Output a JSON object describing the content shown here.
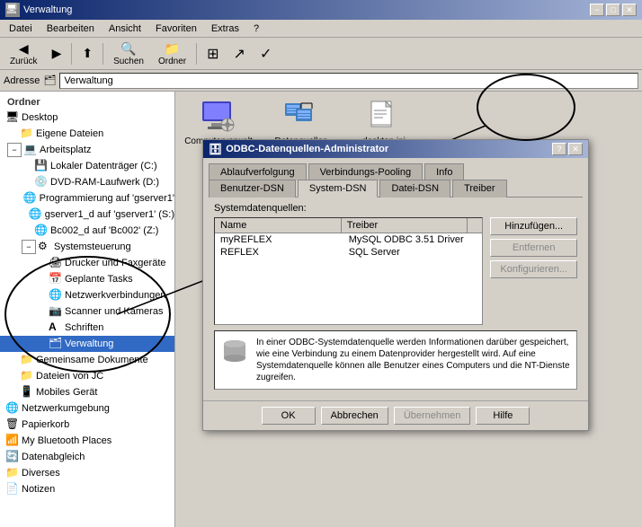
{
  "window": {
    "title": "Verwaltung",
    "title_icon": "🖥",
    "min_btn": "−",
    "max_btn": "□",
    "close_btn": "✕"
  },
  "menu": {
    "items": [
      "Datei",
      "Bearbeiten",
      "Ansicht",
      "Favoriten",
      "Extras",
      "?"
    ]
  },
  "toolbar": {
    "back_label": "Zurück",
    "forward_label": "→",
    "up_label": "↑",
    "search_label": "Suchen",
    "folders_label": "Ordner",
    "views_label": "⊞",
    "move_label": "↗",
    "check_label": "✓"
  },
  "address": {
    "label": "Adresse",
    "value": "Verwaltung",
    "icon": "🗂"
  },
  "sidebar": {
    "header": "Ordner",
    "items": [
      {
        "id": "desktop",
        "label": "Desktop",
        "indent": 0,
        "icon": "🖥",
        "expandable": false
      },
      {
        "id": "eigene",
        "label": "Eigene Dateien",
        "indent": 1,
        "icon": "📁",
        "expandable": false
      },
      {
        "id": "arbeitsplatz",
        "label": "Arbeitsplatz",
        "indent": 1,
        "icon": "💻",
        "expandable": true
      },
      {
        "id": "lokal-c",
        "label": "Lokaler Datenträger (C:)",
        "indent": 2,
        "icon": "💾",
        "expandable": false
      },
      {
        "id": "dvd-d",
        "label": "DVD-RAM-Laufwerk (D:)",
        "indent": 2,
        "icon": "💿",
        "expandable": false
      },
      {
        "id": "prog-gserver",
        "label": "Programmierung auf 'gserver1'",
        "indent": 2,
        "icon": "🌐",
        "expandable": false
      },
      {
        "id": "gserver1",
        "label": "gserver1_d auf 'gserver1' (S:)",
        "indent": 2,
        "icon": "🌐",
        "expandable": false
      },
      {
        "id": "bc002",
        "label": "Bc002_d auf 'Bc002' (Z:)",
        "indent": 2,
        "icon": "🌐",
        "expandable": false
      },
      {
        "id": "systemsteuerung",
        "label": "Systemsteuerung",
        "indent": 2,
        "icon": "⚙",
        "expandable": true
      },
      {
        "id": "drucker",
        "label": "Drucker und Faxgeräte",
        "indent": 3,
        "icon": "🖨",
        "expandable": false
      },
      {
        "id": "geplante",
        "label": "Geplante Tasks",
        "indent": 3,
        "icon": "📅",
        "expandable": false
      },
      {
        "id": "netzwerk",
        "label": "Netzwerkverbindungen",
        "indent": 3,
        "icon": "🌐",
        "expandable": false
      },
      {
        "id": "scanner",
        "label": "Scanner und Kameras",
        "indent": 3,
        "icon": "📷",
        "expandable": false
      },
      {
        "id": "schriften",
        "label": "Schriften",
        "indent": 3,
        "icon": "A",
        "expandable": false
      },
      {
        "id": "verwaltung",
        "label": "Verwaltung",
        "indent": 3,
        "icon": "🗂",
        "expandable": false
      },
      {
        "id": "gemeinsame",
        "label": "Gemeinsame Dokumente",
        "indent": 1,
        "icon": "📁",
        "expandable": false
      },
      {
        "id": "dateien-jc",
        "label": "Dateien von JC",
        "indent": 1,
        "icon": "📁",
        "expandable": false
      },
      {
        "id": "mobiles",
        "label": "Mobiles Gerät",
        "indent": 1,
        "icon": "📱",
        "expandable": false
      },
      {
        "id": "netzwerkumgebung",
        "label": "Netzwerkumgebung",
        "indent": 0,
        "icon": "🌐",
        "expandable": false
      },
      {
        "id": "papierkorb",
        "label": "Papierkorb",
        "indent": 0,
        "icon": "🗑",
        "expandable": false
      },
      {
        "id": "bluetooth",
        "label": "My Bluetooth Places",
        "indent": 0,
        "icon": "📶",
        "expandable": false
      },
      {
        "id": "datenabgleich",
        "label": "Datenabgleich",
        "indent": 0,
        "icon": "🔄",
        "expandable": false
      },
      {
        "id": "diverses",
        "label": "Diverses",
        "indent": 0,
        "icon": "📁",
        "expandable": false
      },
      {
        "id": "notizen",
        "label": "Notizen",
        "indent": 0,
        "icon": "📄",
        "expandable": false
      }
    ]
  },
  "right_panel": {
    "items": [
      {
        "id": "computerverwaltung",
        "label": "Computerverwaltung",
        "icon_type": "computer"
      },
      {
        "id": "datenquellen",
        "label": "Datenquellen (ODBC)",
        "icon_type": "odbc"
      },
      {
        "id": "desktop_ini",
        "label": "desktop.ini",
        "icon_type": "file"
      }
    ]
  },
  "odbc_dialog": {
    "title": "ODBC-Datenquellen-Administrator",
    "title_icon": "🗄",
    "help_btn": "?",
    "close_btn": "✕",
    "tabs": [
      {
        "id": "benutzer",
        "label": "Benutzer-DSN",
        "active": false
      },
      {
        "id": "system",
        "label": "System-DSN",
        "active": true
      },
      {
        "id": "datei",
        "label": "Datei-DSN",
        "active": false
      },
      {
        "id": "treiber",
        "label": "Treiber",
        "active": false
      },
      {
        "id": "ablaufverfolgung",
        "label": "Ablaufverfolgung",
        "active": false
      },
      {
        "id": "verbindungs",
        "label": "Verbindungs-Pooling",
        "active": false
      },
      {
        "id": "info",
        "label": "Info",
        "active": false
      }
    ],
    "section_label": "Systemdatenquellen:",
    "table_headers": [
      "Name",
      "Treiber"
    ],
    "table_rows": [
      {
        "name": "myREFLEX",
        "driver": "MySQL ODBC 3.51 Driver"
      },
      {
        "name": "REFLEX",
        "driver": "SQL Server"
      }
    ],
    "buttons": {
      "add": "Hinzufügen...",
      "remove": "Entfernen",
      "configure": "Konfigurieren..."
    },
    "info_text": "In einer ODBC-Systemdatenquelle werden Informationen darüber gespeichert, wie eine Verbindung zu einem Datenprovider hergestellt wird. Auf eine Systemdatenquelle können alle Benutzer eines Computers und die NT-Dienste  zugreifen.",
    "footer_buttons": {
      "ok": "OK",
      "cancel": "Abbrechen",
      "apply": "Übernehmen",
      "help": "Hilfe"
    }
  }
}
